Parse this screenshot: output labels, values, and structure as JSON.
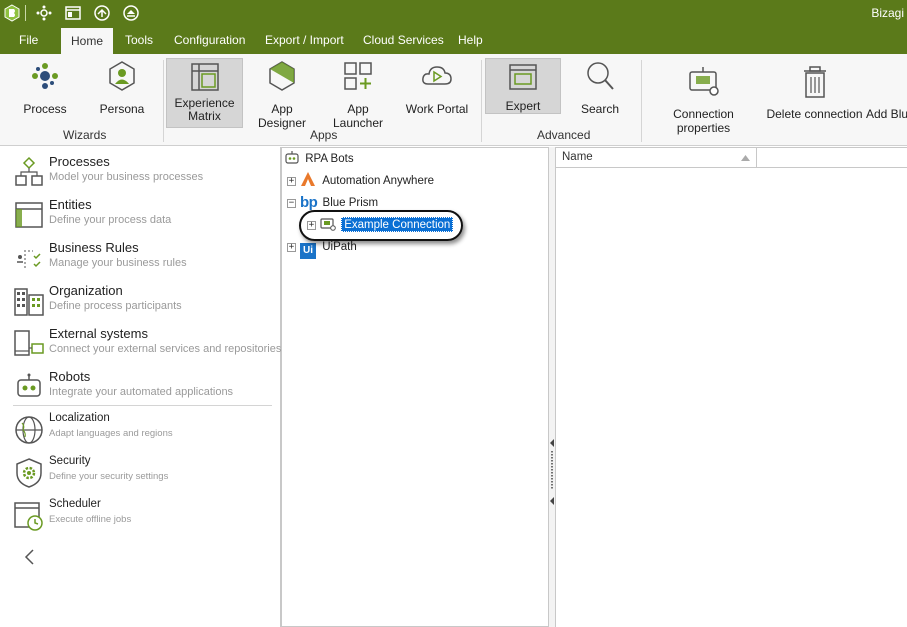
{
  "app": {
    "title": "Bizagi"
  },
  "menu": {
    "items": [
      "File",
      "Home",
      "Tools",
      "Configuration",
      "Export / Import",
      "Cloud Services",
      "Help"
    ],
    "active": "Home"
  },
  "ribbon": {
    "groups": {
      "wizards": "Wizards",
      "apps": "Apps",
      "advanced": "Advanced"
    },
    "buttons": {
      "process": "Process",
      "persona": "Persona",
      "experience_line1": "Experience",
      "experience_line2": "Matrix",
      "app_designer": "App Designer",
      "app_launcher": "App Launcher",
      "work_portal": "Work Portal",
      "expert": "Expert",
      "search": "Search",
      "connection_properties": "Connection properties",
      "delete_connection": "Delete connection",
      "add_blu": "Add Blu"
    }
  },
  "leftnav": {
    "items": [
      {
        "title": "Processes",
        "subtitle": "Model your business processes"
      },
      {
        "title": "Entities",
        "subtitle": "Define your process data"
      },
      {
        "title": "Business Rules",
        "subtitle": "Manage your business rules"
      },
      {
        "title": "Organization",
        "subtitle": "Define process participants"
      },
      {
        "title": "External systems",
        "subtitle": "Connect your external services and repositories"
      },
      {
        "title": "Robots",
        "subtitle": "Integrate your automated applications"
      },
      {
        "title": "Localization",
        "subtitle": "Adapt languages and regions"
      },
      {
        "title": "Security",
        "subtitle": "Define your security settings"
      },
      {
        "title": "Scheduler",
        "subtitle": "Execute offline jobs"
      }
    ]
  },
  "tree": {
    "root": "RPA Bots",
    "nodes": [
      "Automation Anywhere",
      "Blue Prism",
      "Example Connection",
      "UiPath"
    ],
    "selected": "Example Connection"
  },
  "grid": {
    "columns": [
      "Name"
    ]
  },
  "colors": {
    "brand": "#5b7a1a",
    "selection": "#0a6fd4",
    "accent": "#6a9a22"
  }
}
